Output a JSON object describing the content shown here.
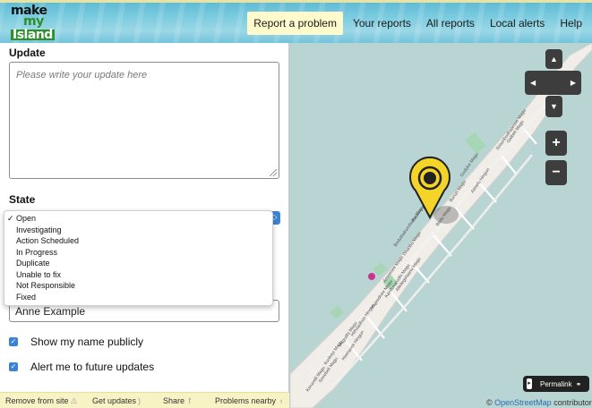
{
  "header": {
    "logo": [
      "make",
      "my",
      "Island"
    ],
    "nav": [
      {
        "label": "Report a problem",
        "primary": true
      },
      {
        "label": "Your reports",
        "primary": false
      },
      {
        "label": "All reports",
        "primary": false
      },
      {
        "label": "Local alerts",
        "primary": false
      },
      {
        "label": "Help",
        "primary": false
      }
    ]
  },
  "sidebar": {
    "update_label": "Update",
    "update_placeholder": "Please write your update here",
    "state_label": "State",
    "state_options": [
      "Open",
      "Investigating",
      "Action Scheduled",
      "In Progress",
      "Duplicate",
      "Unable to fix",
      "Not Responsible",
      "Fixed"
    ],
    "state_selected": "Open",
    "name_value": "Anne Example",
    "show_name_label": "Show my name publicly",
    "alert_label": "Alert me to future updates",
    "footer": {
      "remove": "Remove from site",
      "updates": "Get updates",
      "share": "Share",
      "nearby": "Problems nearby"
    }
  },
  "map": {
    "zoom_in": "+",
    "zoom_out": "−",
    "permalink": "Permalink",
    "attribution_prefix": "©",
    "attribution_link": "OpenStreetMap",
    "attribution_suffix": "contributors",
    "pin_color": "#f5d42a",
    "water_color": "#b8d5d3",
    "land_color": "#f1eeea",
    "street_labels": [
      "Sosunbudhaamee Magu",
      "Godube Magu",
      "Buruzi Magu",
      "Boduthakurufaanu Magu",
      "Dhanbu Magu",
      "Badikoyyaa Goalhi",
      "Ameenee Magu",
      "Alikilegefaanu Magu",
      "Majeedhee Magu",
      "Bodu Magu",
      "Kurikeyi Magu",
      "Hithaadhoo Hingun",
      "Magudhi Magu",
      "Sonebeli Magu",
      "Heenaree Hingun",
      "Kanduvarudhi Magu",
      "Koruvelli Magu",
      "Ashefu Hingun",
      "Galbeli Magu"
    ]
  }
}
